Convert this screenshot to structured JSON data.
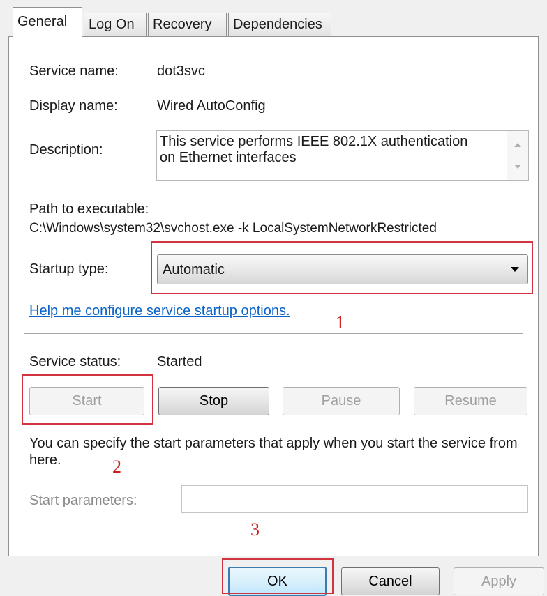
{
  "tabs": [
    "General",
    "Log On",
    "Recovery",
    "Dependencies"
  ],
  "fields": {
    "service_name_label": "Service name:",
    "service_name_value": "dot3svc",
    "display_name_label": "Display name:",
    "display_name_value": "Wired AutoConfig",
    "description_label": "Description:",
    "description_value": "This service performs IEEE 802.1X authentication\non Ethernet interfaces",
    "path_label": "Path to executable:",
    "path_value": "C:\\Windows\\system32\\svchost.exe -k LocalSystemNetworkRestricted",
    "startup_type_label": "Startup type:",
    "startup_type_value": "Automatic",
    "help_link": "Help me configure service startup options.",
    "service_status_label": "Service status:",
    "service_status_value": "Started",
    "start_params_hint": "You can specify the start parameters that apply when you start the service from here.",
    "start_params_label": "Start parameters:",
    "start_params_value": ""
  },
  "service_buttons": {
    "start": "Start",
    "stop": "Stop",
    "pause": "Pause",
    "resume": "Resume"
  },
  "dialog_buttons": {
    "ok": "OK",
    "cancel": "Cancel",
    "apply": "Apply"
  },
  "annotations": [
    "1",
    "2",
    "3"
  ],
  "colors": {
    "annotation_red": "#d1343e",
    "link_blue": "#0a64c8",
    "ok_border": "#3d7bad"
  }
}
